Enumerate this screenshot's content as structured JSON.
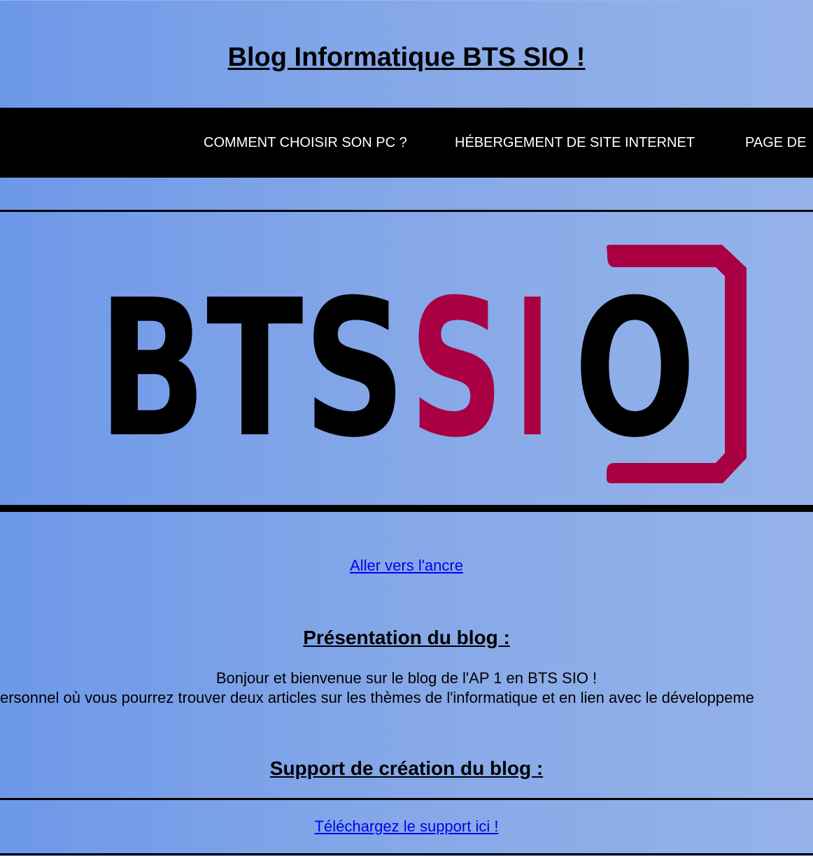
{
  "header": {
    "title": "Blog Informatique BTS SIO !"
  },
  "nav": {
    "items": [
      {
        "label": "COMMENT CHOISIR SON PC ?"
      },
      {
        "label": "HÉBERGEMENT DE SITE INTERNET"
      },
      {
        "label": "PAGE DE"
      }
    ]
  },
  "logo": {
    "text_black_1": "BTS",
    "text_red": "S",
    "text_red_2": "I",
    "text_black_2": "O",
    "colors": {
      "black": "#000000",
      "red": "#a80043"
    }
  },
  "main": {
    "anchor_link": "Aller vers l'ancre",
    "presentation": {
      "heading": "Présentation du blog :",
      "line1": "Bonjour et bienvenue sur le blog de l'AP 1 en BTS SIO !",
      "line2": "ersonnel où vous pourrez trouver deux articles sur les thèmes de l'informatique et en lien avec le développeme"
    },
    "support": {
      "heading": "Support de création du blog :",
      "download_link": "Téléchargez le support ici !"
    }
  },
  "colors": {
    "background_left": "#6d98e8",
    "background_right": "#95b3e9",
    "nav_background": "#000000",
    "link": "#0000ee"
  }
}
